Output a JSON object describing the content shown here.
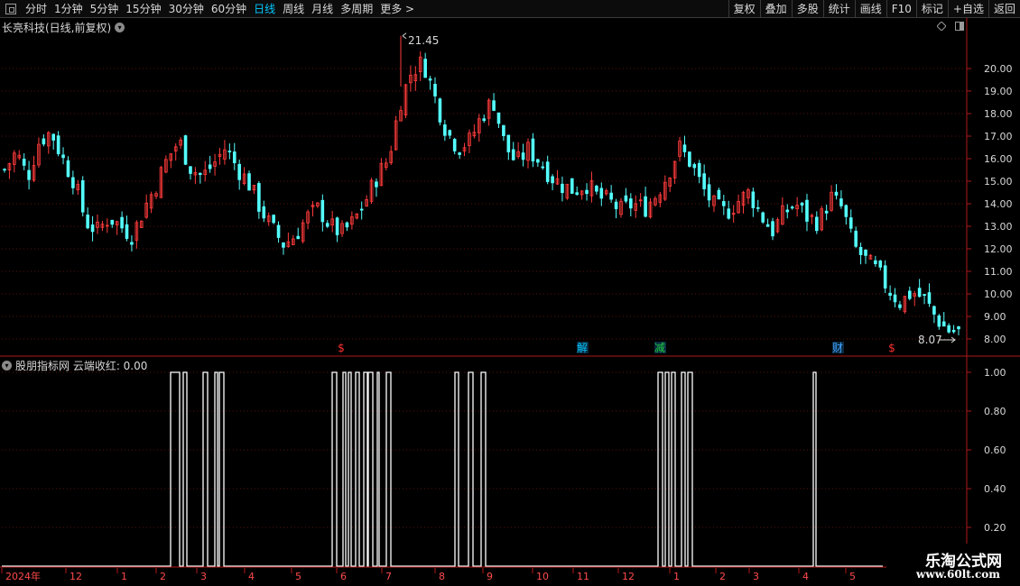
{
  "toolbar": {
    "tabs": [
      {
        "label": "分时",
        "active": false
      },
      {
        "label": "1分钟",
        "active": false
      },
      {
        "label": "5分钟",
        "active": false
      },
      {
        "label": "15分钟",
        "active": false
      },
      {
        "label": "30分钟",
        "active": false
      },
      {
        "label": "60分钟",
        "active": false
      },
      {
        "label": "日线",
        "active": true
      },
      {
        "label": "周线",
        "active": false
      },
      {
        "label": "月线",
        "active": false
      },
      {
        "label": "多周期",
        "active": false
      },
      {
        "label": "更多 >",
        "active": false
      }
    ],
    "right_buttons": [
      "复权",
      "叠加",
      "多股",
      "统计",
      "画线",
      "F10",
      "标记",
      "+自选",
      "返回"
    ]
  },
  "main_chart": {
    "title": "长亮科技(日线,前复权)",
    "high_label": "21.45",
    "low_label": "8.07",
    "price_axis": [
      "20.00",
      "19.00",
      "18.00",
      "17.00",
      "16.00",
      "15.00",
      "14.00",
      "13.00",
      "12.00",
      "11.00",
      "10.00",
      "9.00",
      "8.00"
    ],
    "event_markers": [
      {
        "label": "$",
        "color": "#ff3030"
      },
      {
        "label": "解",
        "color": "#00c8ff"
      },
      {
        "label": "减",
        "color": "#20d040"
      },
      {
        "label": "财",
        "color": "#40a0ff"
      },
      {
        "label": "$",
        "color": "#ff3030"
      }
    ]
  },
  "indicator": {
    "title": "股朋指标网 云端收红: 0.00",
    "axis": [
      "1.00",
      "0.80",
      "0.60",
      "0.40",
      "0.20"
    ]
  },
  "date_axis": [
    "2024年",
    "12",
    "1",
    "2",
    "3",
    "4",
    "5",
    "6",
    "7",
    "8",
    "9",
    "10",
    "11",
    "12",
    "1",
    "2",
    "3",
    "4",
    "5"
  ],
  "watermark": {
    "line1": "乐淘公式网",
    "line2": "www.60lt.com"
  },
  "colors": {
    "up": "#ff3b3b",
    "down": "#54ffff",
    "axis": "#b01818",
    "signal": "#ffffff"
  },
  "chart_data": {
    "type": "candlestick",
    "price_ylim": [
      7.6,
      22.0
    ],
    "price_high": 21.45,
    "price_low": 8.07,
    "signal_ylim": [
      0,
      1.0
    ],
    "close_path": [
      15.5,
      16.3,
      15.2,
      16.8,
      17.2,
      16.0,
      15.0,
      13.2,
      12.8,
      13.4,
      13.0,
      12.6,
      13.8,
      14.8,
      16.0,
      16.8,
      15.6,
      15.2,
      15.8,
      16.5,
      15.6,
      14.9,
      13.8,
      12.9,
      12.2,
      12.6,
      13.4,
      13.8,
      13.0,
      12.7,
      13.2,
      14.1,
      15.2,
      16.0,
      18.5,
      19.9,
      20.3,
      18.7,
      17.2,
      16.5,
      16.8,
      17.9,
      18.6,
      16.6,
      15.8,
      16.4,
      15.9,
      15.2,
      14.8,
      14.6,
      14.9,
      14.3,
      14.1,
      13.7,
      14.0,
      13.8,
      14.4,
      15.3,
      16.5,
      15.8,
      14.7,
      13.9,
      13.6,
      14.1,
      14.5,
      13.5,
      12.8,
      13.6,
      14.0,
      13.4,
      13.2,
      14.3,
      13.8,
      12.1,
      11.5,
      11.0,
      10.2,
      9.6,
      10.1,
      9.8,
      9.0,
      8.4,
      8.3
    ]
  }
}
